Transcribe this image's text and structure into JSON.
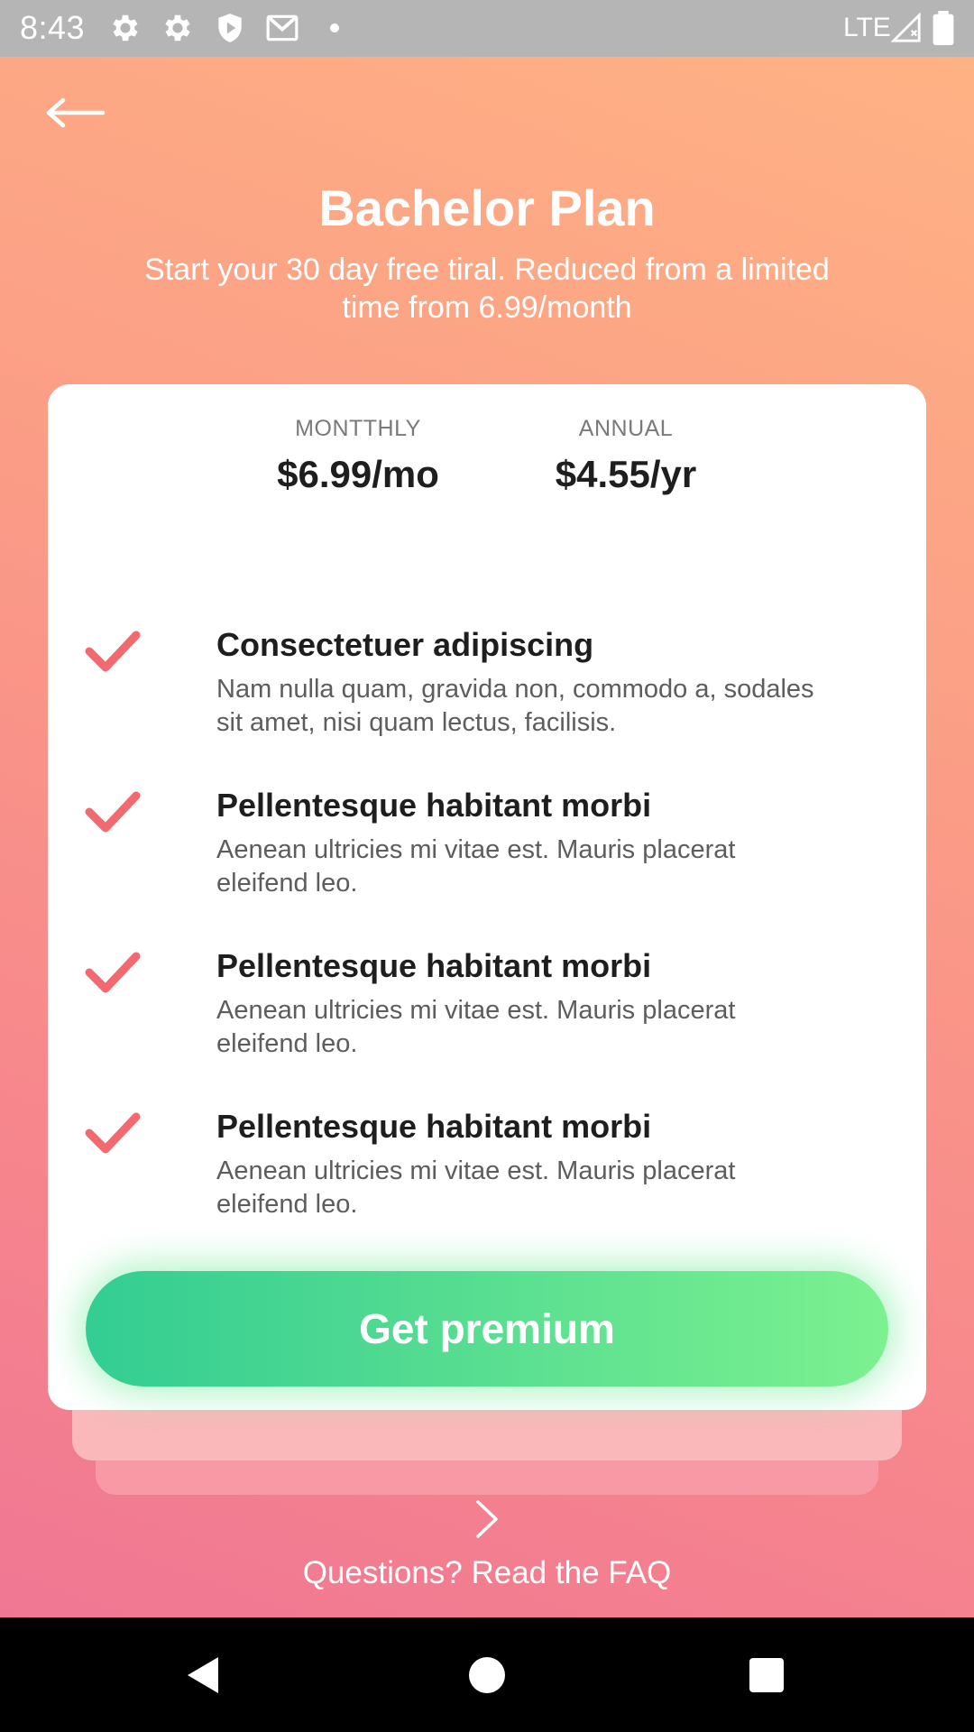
{
  "status_bar": {
    "time": "8:43",
    "icons": [
      "gear-icon",
      "gear-icon",
      "shield-play-icon",
      "mail-icon",
      "dot-icon"
    ],
    "network": "LTE",
    "right_icons": [
      "signal-icon",
      "battery-icon"
    ]
  },
  "header": {
    "back_icon": "arrow-left-icon",
    "title": "Bachelor Plan",
    "subtitle": "Start your 30 day free tiral. Reduced from a limited time from 6.99/month"
  },
  "plans": [
    {
      "label": "MONTTHLY",
      "price": "$6.99/mo"
    },
    {
      "label": "ANNUAL",
      "price": "$4.55/yr"
    }
  ],
  "features": [
    {
      "title": "Consectetuer adipiscing",
      "description": "Nam nulla quam, gravida non, commodo a, sodales sit amet, nisi quam lectus, facilisis."
    },
    {
      "title": "Pellentesque habitant morbi",
      "description": "Aenean ultricies mi vitae est. Mauris placerat eleifend leo."
    },
    {
      "title": "Pellentesque habitant morbi",
      "description": "Aenean ultricies mi vitae est. Mauris placerat eleifend leo."
    },
    {
      "title": "Pellentesque habitant morbi",
      "description": "Aenean ultricies mi vitae est. Mauris placerat eleifend leo."
    }
  ],
  "cta": {
    "label": "Get premium"
  },
  "faq": {
    "label": "Questions? Read the FAQ",
    "icon": "chevron-right-icon"
  },
  "colors": {
    "check": "#f26a6f",
    "button_start": "#33cd93",
    "button_end": "#7cf190",
    "background_top": "#ffb284",
    "background_bottom": "#f07793"
  },
  "nav_bar": [
    "nav-back-icon",
    "nav-home-icon",
    "nav-recents-icon"
  ]
}
